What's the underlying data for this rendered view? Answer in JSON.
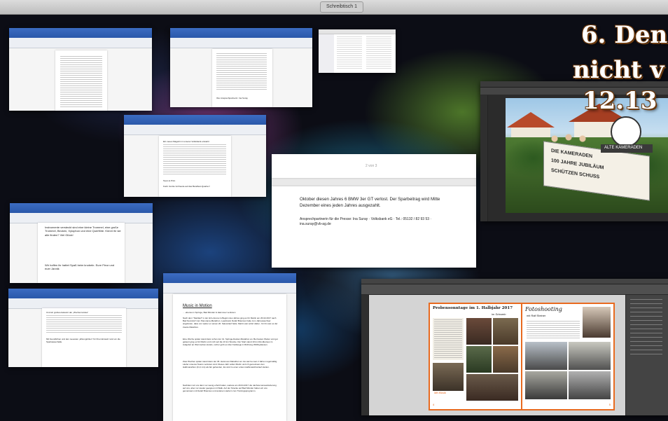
{
  "topbar": {
    "title": "Schreibtisch 1"
  },
  "overlay": {
    "line1": "6. Den",
    "line2": "nicht v",
    "line3": "12.13 "
  },
  "word_top_middle": {
    "footer_line": "Ihre Ansprechpartnerin: Ina Suray"
  },
  "word_mid": {
    "line_a": "Ein neues Magazin in unserer Volksbank entsteht",
    "signature": "Team & Print",
    "closing": "Fazit: Große Vorfreude auf das Bandfest-Quartier!"
  },
  "word_large": {
    "page_indicator": "2 von 3",
    "para1": "Oktober diesen Jahres 6 BMW 3er GT verlost. Der Sparbeitrag wird Mitte Dezember eines jeden Jahres ausgezahlt.",
    "para2": "Ansprechpartnerin für die Presse: Ina Suray · Volksbank eG · Tel.: 05132 / 82 93 53 · ina.suray@vb-ag.de"
  },
  "word_left_mid": {
    "para1": "Instrumente versteckt sind eine kleine Trommel, eine große Trommel, Becken, Xylophon und eine Querflöte. Könnt ihr sie alle finden? Viel Glück!",
    "para2": "Wir hoffen ihr hattet Spaß beim knobeln. Eure Fleur und euer Jannik"
  },
  "word_bottom_left": {
    "heading": "Und wir großes-bekannt der „Wochenrundes\"",
    "closing": "Mit freundlichen und den neuesten „Ehrengrüßen\" für Ihren Einsatz rund um die Sparkassenhalle."
  },
  "word_music": {
    "title": "Music in Motion",
    "subtitle": "… ebenso in Springe, Bad Münder & Hannover vertreten",
    "para1": "Nach dem \"Startlauf\" in der Hirn-Arena zu Beginn des Jahres ging es für Martin am 26.02.2017 nach Bad Nenndorf zum Panorama-Marathon. Leadmann Detlef Brasmus hatte zum Jahreswechsel angeboten, dass von wetter er seinen 20. Saisonlauf hatte. Martin war sofort dabei - für ihn war es der zweite Marathon.",
    "para2": "Eine Woche später stand dann schon der 41. Springe-Deister-Marathon an. Bei besten Wetter und gut gelaunt ging es für Martin und mich auf die 10 km Strecke. Der Start stand 10 km Rundkurses im Aufgebot an Wermsehen-Hotels, vorher geht es über Feldwege in Richtung Wülfinghausen.",
    "para3": "Zwei Wochen später stand dann der 36. Hannover-Marathon an. Es war bei wet 2 Jahren regelmäßig Läufer unseres Teams vertreten sind. Dieses Jahr sollen Martin und ich gemeinsam den Halbmarathon (21,1 km) als fair gehenden, Es sind zu einer ersten Halbmarathonlauf starten.",
    "para4": "Nachdem wir uns dann vor wenig erholt hatten, wartete am 29.04.2017 die nächste Herausforderung auf uns, aber nur wieder geeignet mit Walk. Auf der Strecke auf Bad Münder haben wir uns gemeinsam mit Detlef Brasmus und anderen Läufern zum Trainingsprogramm."
  },
  "indesign": {
    "left_title": "Probensonntage im 1. Halbjahr 2017",
    "left_sub": "im Schwein",
    "right_title": "Fotoshooting",
    "right_sub": "mit Ralf Steiner",
    "left_note": "Mit Musik",
    "left_pagenum": "4",
    "right_pagenum": "5"
  },
  "photoshop": {
    "sign_top": "ALTE KAMERADEN",
    "banner_line1": "DIE KAMERADEN",
    "banner_line2": "100 JAHRE JUBILÄUM",
    "banner_line3": "SCHÜTZEN SCHUSS"
  },
  "colors": {
    "word_ribbon": "#2f5fb3",
    "indesign_accent": "#e86a1f",
    "heading_outline": "#6b3a10"
  }
}
